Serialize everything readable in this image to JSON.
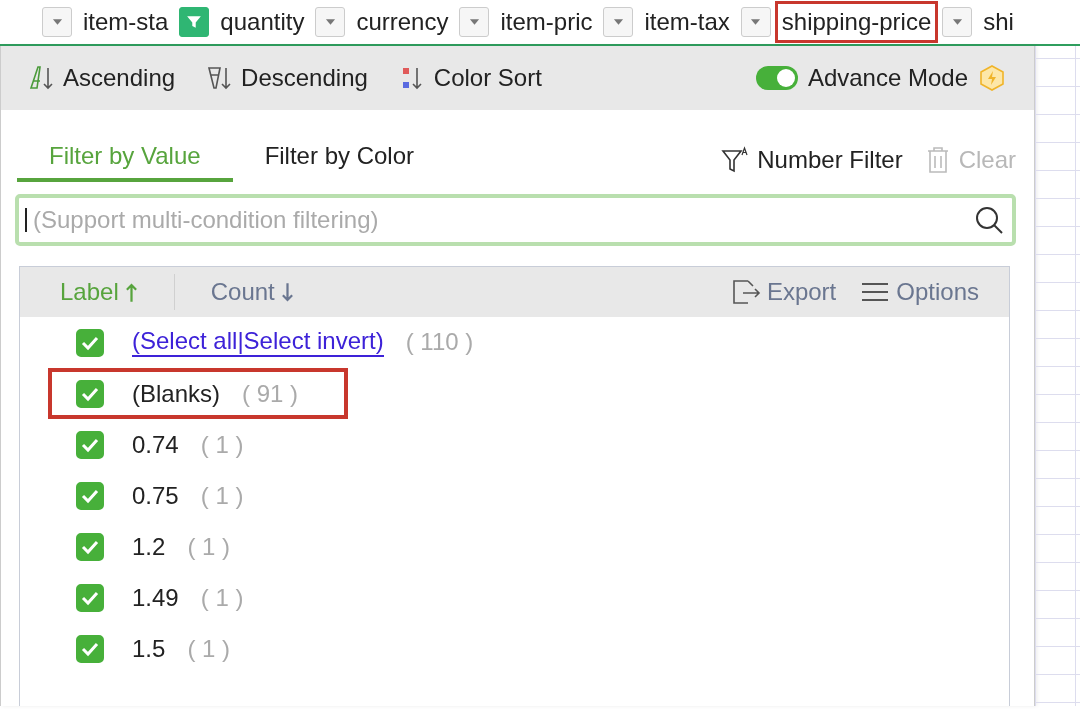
{
  "header_cells": [
    {
      "kind": "dropdown",
      "filtered": false
    },
    {
      "kind": "label",
      "text": "item-sta",
      "highlighted": false
    },
    {
      "kind": "dropdown",
      "filtered": true
    },
    {
      "kind": "label",
      "text": "quantity",
      "highlighted": false
    },
    {
      "kind": "dropdown",
      "filtered": false
    },
    {
      "kind": "label",
      "text": "currency",
      "highlighted": false
    },
    {
      "kind": "dropdown",
      "filtered": false
    },
    {
      "kind": "label",
      "text": "item-pric",
      "highlighted": false
    },
    {
      "kind": "dropdown",
      "filtered": false
    },
    {
      "kind": "label",
      "text": "item-tax",
      "highlighted": false
    },
    {
      "kind": "dropdown",
      "filtered": false
    },
    {
      "kind": "label",
      "text": "shipping-price",
      "highlighted": true
    },
    {
      "kind": "dropdown",
      "filtered": false
    },
    {
      "kind": "label",
      "text": "shi",
      "highlighted": false
    }
  ],
  "sort_bar": {
    "buttons": [
      {
        "kind": "ascending",
        "label": "Ascending"
      },
      {
        "kind": "descending",
        "label": "Descending"
      },
      {
        "kind": "color",
        "label": "Color Sort"
      }
    ],
    "advance_mode": {
      "label": "Advance Mode",
      "on": true
    }
  },
  "tabs": [
    {
      "label": "Filter by Value",
      "selected": true
    },
    {
      "label": "Filter by Color",
      "selected": false
    }
  ],
  "actions": [
    {
      "kind": "number_filter",
      "label": "Number Filter",
      "disabled": false
    },
    {
      "kind": "clear",
      "label": "Clear",
      "disabled": true
    }
  ],
  "search": {
    "placeholder": "(Support multi-condition filtering)"
  },
  "list_header": {
    "columns": [
      {
        "label": "Label",
        "kind": "ascending",
        "active": true
      },
      {
        "label": "Count",
        "kind": "descending",
        "active": false
      }
    ],
    "actions": [
      {
        "kind": "export",
        "label": "Export"
      },
      {
        "kind": "options",
        "label": "Options"
      }
    ]
  },
  "rows": [
    {
      "kind": "select_all",
      "links": [
        "(Select all",
        "|Select invert)"
      ],
      "count": "( 110 )",
      "checked": true,
      "highlighted": false
    },
    {
      "kind": "value",
      "label": "(Blanks)",
      "count": "( 91 )",
      "checked": true,
      "highlighted": true
    },
    {
      "kind": "value",
      "label": "0.74",
      "count": "( 1 )",
      "checked": true,
      "highlighted": false
    },
    {
      "kind": "value",
      "label": "0.75",
      "count": "( 1 )",
      "checked": true,
      "highlighted": false
    },
    {
      "kind": "value",
      "label": "1.2",
      "count": "( 1 )",
      "checked": true,
      "highlighted": false
    },
    {
      "kind": "value",
      "label": "1.49",
      "count": "( 1 )",
      "checked": true,
      "highlighted": false
    },
    {
      "kind": "value",
      "label": "1.5",
      "count": "( 1 )",
      "checked": true,
      "highlighted": false
    }
  ]
}
